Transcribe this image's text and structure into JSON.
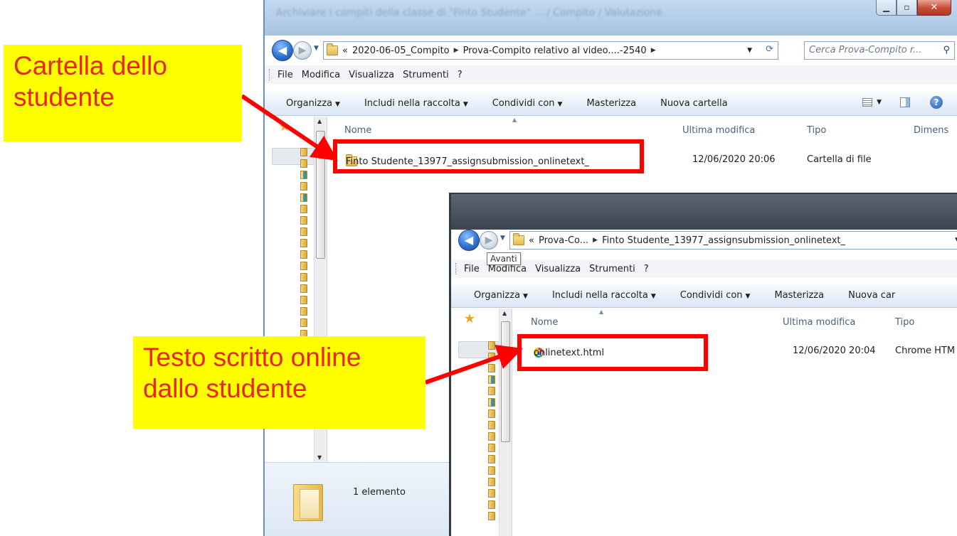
{
  "win1": {
    "title": "Archiviare i compiti della classe di \"Finto Studente\" ... / Compito / Valutazione",
    "address": {
      "prefix": "«",
      "crumbs": [
        "2020-06-05_Compito",
        "Prova-Compito relativo al video....-2540"
      ]
    },
    "search_placeholder": "Cerca Prova-Compito r...",
    "menu": [
      "File",
      "Modifica",
      "Visualizza",
      "Strumenti",
      "?"
    ],
    "commands": [
      "Organizza",
      "Includi nella raccolta",
      "Condividi con",
      "Masterizza",
      "Nuova cartella"
    ],
    "columns": {
      "name": "Nome",
      "modified": "Ultima modifica",
      "type": "Tipo",
      "size": "Dimens"
    },
    "rows": [
      {
        "name": "Finto Studente_13977_assignsubmission_onlinetext_",
        "modified": "12/06/2020 20:06",
        "type": "Cartella di file"
      }
    ],
    "status": "1 elemento"
  },
  "win2": {
    "address": {
      "prefix": "«",
      "crumbs": [
        "Prova-Co...",
        "Finto Studente_13977_assignsubmission_onlinetext_"
      ]
    },
    "tooltip": "Avanti",
    "menu": [
      "File",
      "Modifica",
      "Visualizza",
      "Strumenti",
      "?"
    ],
    "commands": [
      "Organizza",
      "Includi nella raccolta",
      "Condividi con",
      "Masterizza",
      "Nuova car"
    ],
    "columns": {
      "name": "Nome",
      "modified": "Ultima modifica",
      "type": "Tipo"
    },
    "rows": [
      {
        "name": "onlinetext.html",
        "modified": "12/06/2020 20:04",
        "type": "Chrome HTM"
      }
    ]
  },
  "callouts": {
    "folder": [
      "Cartella dello",
      "studente"
    ],
    "text": [
      "Testo scritto online",
      "dallo studente"
    ]
  },
  "icons": {
    "caption": [
      "minimize-icon",
      "maximize-icon",
      "close-icon"
    ],
    "nav": [
      "back-arrow-icon",
      "forward-arrow-icon",
      "refresh-icon",
      "search-icon",
      "help-icon"
    ]
  },
  "colors": {
    "highlight": "#ff0000",
    "callout_bg": "#ffff00",
    "callout_text": "#e8261e"
  }
}
